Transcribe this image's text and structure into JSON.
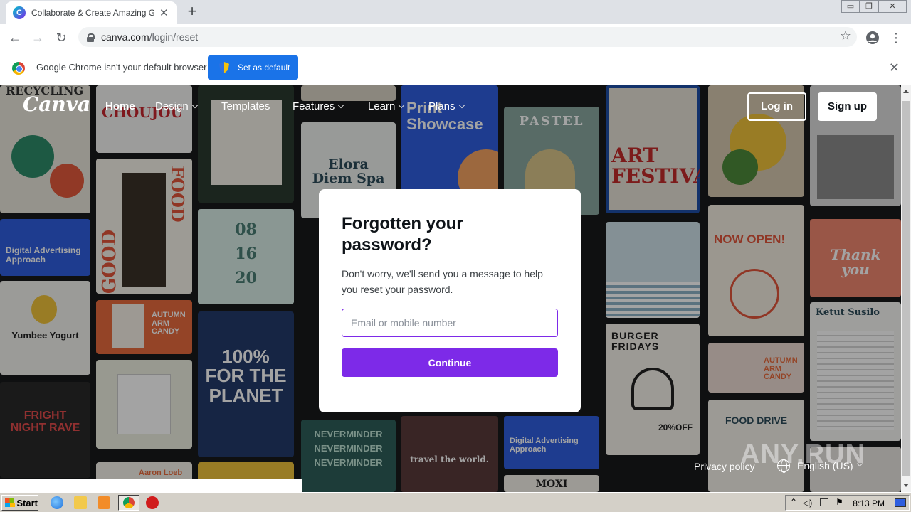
{
  "browser": {
    "tab": {
      "title": "Collaborate & Create Amazing Graphi",
      "close": "✕",
      "favicon": "C"
    },
    "new_tab": "+",
    "window_controls": [
      "▭",
      "❐",
      "✕"
    ],
    "nav": {
      "back": "←",
      "forward": "→",
      "reload": "↻",
      "star": "☆",
      "menu": "⋮"
    },
    "url": {
      "host": "canva.com",
      "path": "/login/reset"
    },
    "infobar": {
      "text": "Google Chrome isn't your default browser",
      "button": "Set as default",
      "close": "✕"
    }
  },
  "site": {
    "logo": "Canva",
    "nav": [
      {
        "label": "Home",
        "active": true,
        "dropdown": false
      },
      {
        "label": "Design",
        "active": false,
        "dropdown": true
      },
      {
        "label": "Templates",
        "active": false,
        "dropdown": false
      },
      {
        "label": "Features",
        "active": false,
        "dropdown": true
      },
      {
        "label": "Learn",
        "active": false,
        "dropdown": true
      },
      {
        "label": "Plans",
        "active": false,
        "dropdown": true
      }
    ],
    "login": "Log in",
    "signup": "Sign up"
  },
  "reset_card": {
    "title": "Forgotten your password?",
    "description": "Don't worry, we'll send you a message to help you reset your password.",
    "input_placeholder": "Email or mobile number",
    "button": "Continue"
  },
  "footer": {
    "privacy": "Privacy policy",
    "language": "English (US)"
  },
  "watermark": "ANY.RUN",
  "tiles": {
    "recycling": "RECYCLING",
    "choujou": "CHOUJOU",
    "elora": "Elora Diem Spa",
    "print": "Print Showcase",
    "pastel": "PASTEL",
    "art": "ART FESTIVAL",
    "digital": "Digital Advertising Approach",
    "food": "FOOD",
    "good": "GOOD",
    "date_1": "08",
    "date_2": "16",
    "date_3": "20",
    "yumbee": "Yumbee Yogurt",
    "autumn_1": "AUTUMN ARM CANDY",
    "planet": "100% FOR THE PLANET",
    "now_open": "NOW OPEN!",
    "thank_you": "Thank you",
    "burger": "BURGER FRIDAYS",
    "burger_off": "20%OFF",
    "ketut": "Ketut Susilo",
    "autumn_2": "AUTUMN ARM CANDY",
    "fright": "FRIGHT NIGHT RAVE",
    "nevermind": "NEVERMINDER",
    "travel": "travel the world.",
    "digital_2": "Digital Advertising Approach",
    "food_drive": "FOOD DRIVE",
    "aaron": "Aaron Loeb",
    "moxi": "MOXI"
  },
  "taskbar": {
    "start": "Start",
    "clock": "8:13 PM"
  },
  "colors": {
    "brand_purple": "#7d2ae8",
    "chrome_blue": "#1a73e8"
  }
}
